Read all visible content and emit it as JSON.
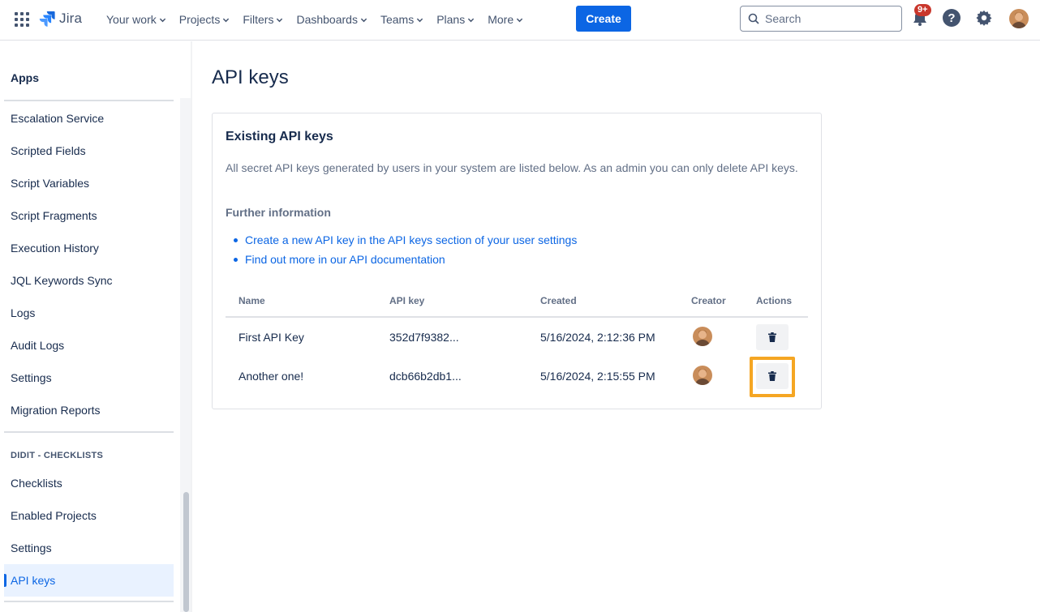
{
  "nav": {
    "logo_text": "Jira",
    "menu": [
      {
        "label": "Your work"
      },
      {
        "label": "Projects"
      },
      {
        "label": "Filters"
      },
      {
        "label": "Dashboards"
      },
      {
        "label": "Teams"
      },
      {
        "label": "Plans"
      },
      {
        "label": "More"
      }
    ],
    "create_label": "Create",
    "search_placeholder": "Search",
    "notification_badge": "9+",
    "help_symbol": "?"
  },
  "sidebar": {
    "heading": "Apps",
    "items": [
      {
        "label": "Escalation Service"
      },
      {
        "label": "Scripted Fields"
      },
      {
        "label": "Script Variables"
      },
      {
        "label": "Script Fragments"
      },
      {
        "label": "Execution History"
      },
      {
        "label": "JQL Keywords Sync"
      },
      {
        "label": "Logs"
      },
      {
        "label": "Audit Logs"
      },
      {
        "label": "Settings"
      },
      {
        "label": "Migration Reports"
      }
    ],
    "group_heading": "DIDIT - CHECKLISTS",
    "group_items": [
      {
        "label": "Checklists"
      },
      {
        "label": "Enabled Projects"
      },
      {
        "label": "Settings"
      },
      {
        "label": "API keys",
        "active": true
      }
    ]
  },
  "main": {
    "title": "API keys",
    "card": {
      "title": "Existing API keys",
      "description": "All secret API keys generated by users in your system are listed below. As an admin you can only delete API keys.",
      "further_heading": "Further information",
      "links": [
        {
          "label": "Create a new API key in the API keys section of your user settings"
        },
        {
          "label": "Find out more in our API documentation"
        }
      ],
      "table": {
        "headers": {
          "name": "Name",
          "key": "API key",
          "created": "Created",
          "creator": "Creator",
          "actions": "Actions"
        },
        "rows": [
          {
            "name": "First API Key",
            "key": "352d7f9382...",
            "created": "5/16/2024, 2:12:36 PM"
          },
          {
            "name": "Another one!",
            "key": "dcb66b2db1...",
            "created": "5/16/2024, 2:15:55 PM"
          }
        ]
      }
    }
  },
  "colors": {
    "accent": "#0c66e4",
    "highlight": "#f5a623",
    "badge": "#c9372c"
  }
}
